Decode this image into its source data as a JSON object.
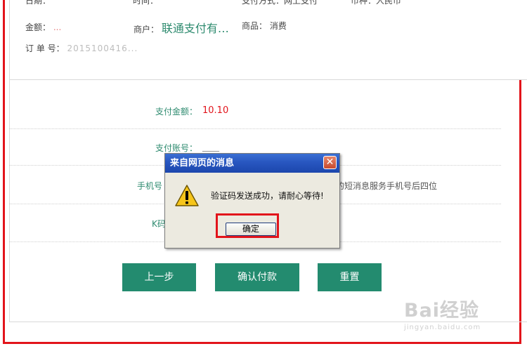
{
  "order_info": {
    "top_cut_1": "日期：",
    "top_cut_2": "时间：",
    "top_cut_3": "支付方式：网上支付",
    "top_cut_4": "币种：人民币",
    "amount_label": "金额：",
    "amount_value": "...",
    "merchant_label": "商户：",
    "merchant_value": "联通支付有…",
    "goods_label": "商品：",
    "goods_value": "消费",
    "order_no_label": "订 单 号：",
    "order_no_value": "2015100416..."
  },
  "form": {
    "pay_amount_label": "支付金额：",
    "pay_amount_value": "10.10",
    "pay_account_label": "支付账号：",
    "pay_account_value": "____",
    "phone_label": "手机号",
    "phone_hint": "的短消息服务手机号后四位",
    "code_label": "K码"
  },
  "buttons": {
    "prev": "上一步",
    "confirm_pay": "确认付款",
    "reset": "重置"
  },
  "dialog": {
    "title": "来自网页的消息",
    "close_symbol": "✕",
    "message": "验证码发送成功，请耐心等待!",
    "ok_label": "确定"
  },
  "watermark": {
    "main": "Bai经验",
    "sub": "jingyan.baidu.com"
  },
  "colors": {
    "highlight_red": "#e2141b",
    "button_green": "#238b6f",
    "label_green": "#2e8b6f",
    "dialog_title_blue": "#2856c0"
  }
}
